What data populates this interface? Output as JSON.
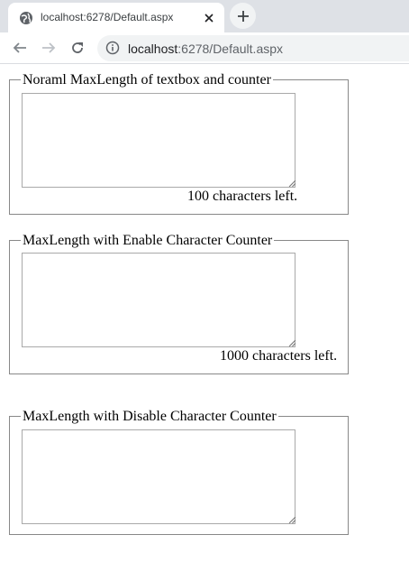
{
  "browser": {
    "tab_title": "localhost:6278/Default.aspx",
    "url_host": "localhost",
    "url_rest": ":6278/Default.aspx"
  },
  "sections": [
    {
      "legend": "Noraml MaxLength of textbox and counter",
      "textarea_value": "",
      "counter": "100 characters left."
    },
    {
      "legend": "MaxLength with Enable Character Counter",
      "textarea_value": "",
      "counter": "1000 characters left."
    },
    {
      "legend": "MaxLength with Disable Character Counter",
      "textarea_value": ""
    }
  ],
  "icons": {
    "favicon": "globe-icon",
    "close": "close-icon",
    "new_tab": "plus-icon",
    "back": "arrow-left-icon",
    "forward": "arrow-right-icon",
    "reload": "reload-icon",
    "site_info": "info-icon"
  }
}
